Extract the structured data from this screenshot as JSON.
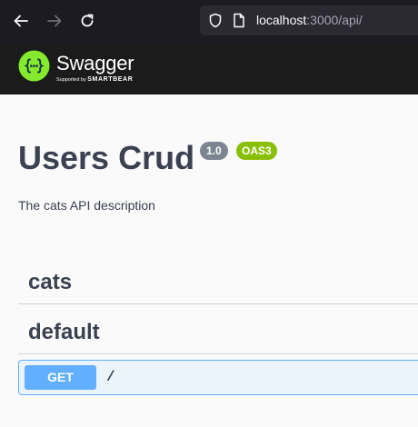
{
  "browser": {
    "url_host": "localhost",
    "url_rest": ":3000/api/",
    "icons": [
      "back-arrow-icon",
      "forward-arrow-icon",
      "reload-icon",
      "shield-icon",
      "page-icon"
    ]
  },
  "swagger": {
    "logo_name": "Swagger",
    "logo_supported": "Supported by ",
    "logo_brand": "SMARTBEAR"
  },
  "info": {
    "title": "Users Crud",
    "version": "1.0",
    "oas": "OAS3",
    "description": "The cats API description"
  },
  "tags": [
    {
      "name": "cats"
    },
    {
      "name": "default"
    }
  ],
  "operations": [
    {
      "method": "GET",
      "path": "/"
    }
  ],
  "colors": {
    "topbar": "#1b1b1b",
    "logo_green": "#85ea2d",
    "get_blue": "#61affe",
    "oas_green": "#89bf04",
    "text": "#3b4151"
  }
}
